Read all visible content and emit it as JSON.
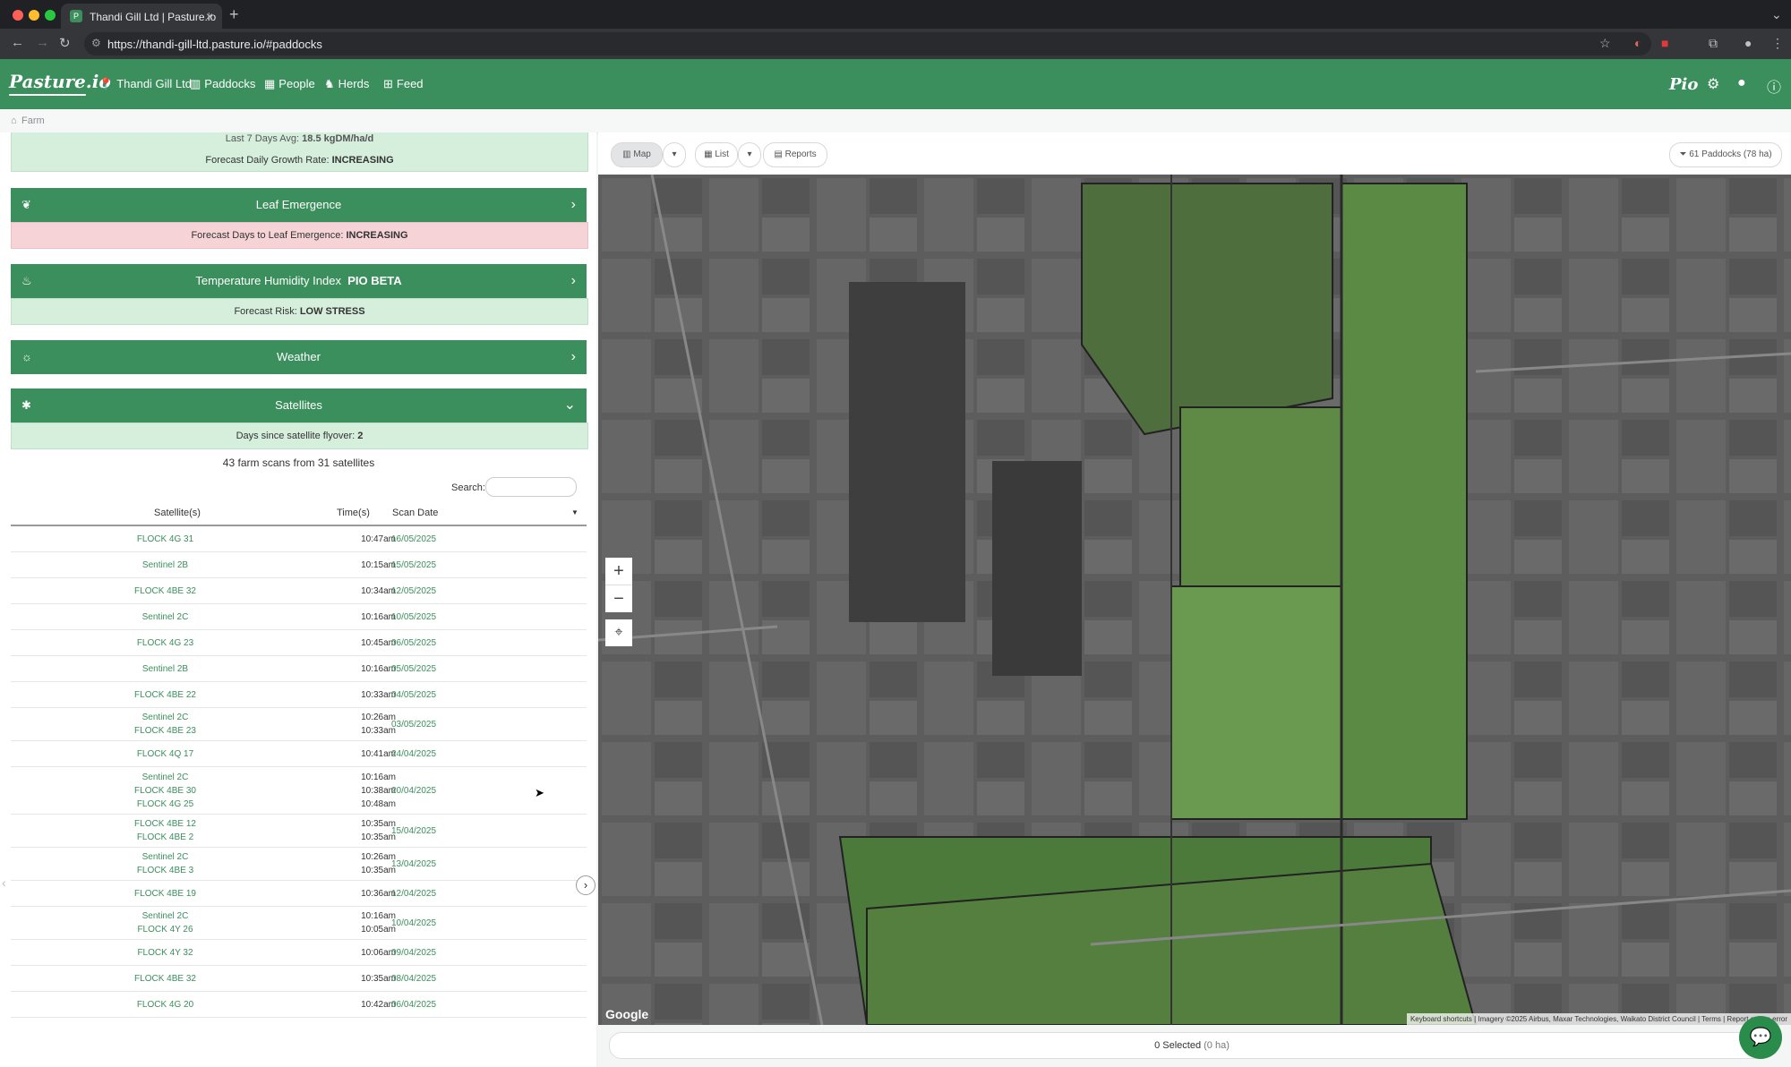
{
  "browser": {
    "tab_title": "Thandi Gill Ltd | Pasture.io",
    "url": "https://thandi-gill-ltd.pasture.io/#paddocks"
  },
  "nav": {
    "logo": "Pasture.io",
    "farm": "Thandi Gill Ltd",
    "paddocks": "Paddocks",
    "people": "People",
    "herds": "Herds",
    "feed": "Feed",
    "pio": "Pio"
  },
  "breadcrumb": {
    "farm": "Farm"
  },
  "panel": {
    "last7_prefix": "Last 7 Days Avg:",
    "last7_value": "18.5 kgDM/ha/d",
    "growth_rate_label": "Forecast Daily Growth Rate:",
    "growth_rate_value": "INCREASING",
    "leaf_title": "Leaf Emergence",
    "leaf_label": "Forecast Days to Leaf Emergence:",
    "leaf_value": "INCREASING",
    "thi_title": "Temperature Humidity Index",
    "thi_badge": "PIO BETA",
    "thi_label": "Forecast Risk:",
    "thi_value": "LOW STRESS",
    "weather_title": "Weather",
    "sat_title": "Satellites",
    "flyover_label": "Days since satellite flyover:",
    "flyover_value": "2",
    "scans_summary": "43 farm scans from 31 satellites",
    "search_label": "Search:"
  },
  "table": {
    "headers": [
      "Satellite(s)",
      "Time(s)",
      "Scan Date"
    ],
    "rows": [
      {
        "sats": [
          "FLOCK 4G 31"
        ],
        "times": [
          "10:47am"
        ],
        "date": "16/05/2025"
      },
      {
        "sats": [
          "Sentinel 2B"
        ],
        "times": [
          "10:15am"
        ],
        "date": "15/05/2025"
      },
      {
        "sats": [
          "FLOCK 4BE 32"
        ],
        "times": [
          "10:34am"
        ],
        "date": "12/05/2025"
      },
      {
        "sats": [
          "Sentinel 2C"
        ],
        "times": [
          "10:16am"
        ],
        "date": "10/05/2025"
      },
      {
        "sats": [
          "FLOCK 4G 23"
        ],
        "times": [
          "10:45am"
        ],
        "date": "06/05/2025"
      },
      {
        "sats": [
          "Sentinel 2B"
        ],
        "times": [
          "10:16am"
        ],
        "date": "05/05/2025"
      },
      {
        "sats": [
          "FLOCK 4BE 22"
        ],
        "times": [
          "10:33am"
        ],
        "date": "04/05/2025"
      },
      {
        "sats": [
          "Sentinel 2C",
          "FLOCK 4BE 23"
        ],
        "times": [
          "10:26am",
          "10:33am"
        ],
        "date": "03/05/2025"
      },
      {
        "sats": [
          "FLOCK 4Q 17"
        ],
        "times": [
          "10:41am"
        ],
        "date": "24/04/2025"
      },
      {
        "sats": [
          "Sentinel 2C",
          "FLOCK 4BE 30",
          "FLOCK 4G 25"
        ],
        "times": [
          "10:16am",
          "10:38am",
          "10:48am"
        ],
        "date": "20/04/2025"
      },
      {
        "sats": [
          "FLOCK 4BE 12",
          "FLOCK 4BE 2"
        ],
        "times": [
          "10:35am",
          "10:35am"
        ],
        "date": "15/04/2025"
      },
      {
        "sats": [
          "Sentinel 2C",
          "FLOCK 4BE 3"
        ],
        "times": [
          "10:26am",
          "10:35am"
        ],
        "date": "13/04/2025"
      },
      {
        "sats": [
          "FLOCK 4BE 19"
        ],
        "times": [
          "10:36am"
        ],
        "date": "12/04/2025"
      },
      {
        "sats": [
          "Sentinel 2C",
          "FLOCK 4Y 26"
        ],
        "times": [
          "10:16am",
          "10:05am"
        ],
        "date": "10/04/2025"
      },
      {
        "sats": [
          "FLOCK 4Y 32"
        ],
        "times": [
          "10:06am"
        ],
        "date": "09/04/2025"
      },
      {
        "sats": [
          "FLOCK 4BE 32"
        ],
        "times": [
          "10:35am"
        ],
        "date": "08/04/2025"
      },
      {
        "sats": [
          "FLOCK 4G 20"
        ],
        "times": [
          "10:42am"
        ],
        "date": "06/04/2025"
      }
    ]
  },
  "map": {
    "map_btn": "Map",
    "list_btn": "List",
    "reports_btn": "Reports",
    "paddocks_filter": "61 Paddocks (78 ha)",
    "google": "Google",
    "attribution": "Keyboard shortcuts | Imagery ©2025 Airbus, Maxar Technologies, Waikato District Council | Terms | Report a map error",
    "selected": "0 Selected",
    "selected_ha": "(0 ha)"
  },
  "colors": {
    "brand_green": "#3a8f5c",
    "mint": "#d6efdc",
    "pink": "#f6d3d6"
  }
}
